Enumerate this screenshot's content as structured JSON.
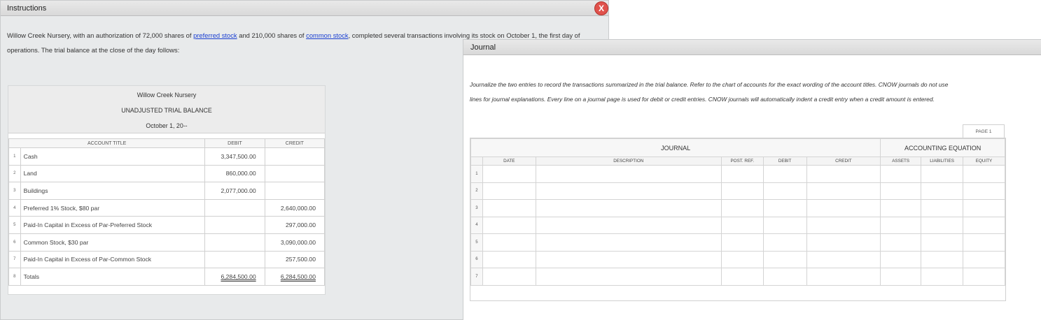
{
  "instructions_window": {
    "title": "Instructions",
    "close_label": "X",
    "intro_part1": "Willow Creek Nursery, with an authorization of 72,000 shares of ",
    "link_preferred": "preferred stock",
    "intro_part2": " and 210,000 shares of ",
    "link_common": "common stock",
    "intro_part3": ", completed several transactions involving its stock on October 1, the first day of operations. The trial balance at the close of the day follows:"
  },
  "trial_balance": {
    "company": "Willow Creek Nursery",
    "title": "UNADJUSTED TRIAL BALANCE",
    "date": "October 1, 20--",
    "columns": [
      "ACCOUNT TITLE",
      "DEBIT",
      "CREDIT"
    ],
    "rows": [
      {
        "num": "1",
        "account": "Cash",
        "debit": "3,347,500.00",
        "credit": ""
      },
      {
        "num": "2",
        "account": "Land",
        "debit": "860,000.00",
        "credit": ""
      },
      {
        "num": "3",
        "account": "Buildings",
        "debit": "2,077,000.00",
        "credit": ""
      },
      {
        "num": "4",
        "account": "Preferred 1% Stock, $80 par",
        "debit": "",
        "credit": "2,640,000.00"
      },
      {
        "num": "5",
        "account": "Paid-In Capital in Excess of Par-Preferred Stock",
        "debit": "",
        "credit": "297,000.00"
      },
      {
        "num": "6",
        "account": "Common Stock, $30 par",
        "debit": "",
        "credit": "3,090,000.00"
      },
      {
        "num": "7",
        "account": "Paid-In Capital in Excess of Par-Common Stock",
        "debit": "",
        "credit": "257,500.00"
      },
      {
        "num": "8",
        "account": "Totals",
        "debit": "6,284,500.00",
        "credit": "6,284,500.00"
      }
    ]
  },
  "journal_window": {
    "title": "Journal",
    "note_line1": "Journalize the two entries to record the transactions summarized in the trial balance. Refer to the chart of accounts for the exact wording of the account titles. CNOW journals do not use",
    "note_line2": "lines for journal explanations. Every line on a journal page is used for debit or credit entries. CNOW journals will automatically indent a credit entry when a credit amount is entered.",
    "page_label": "PAGE 1",
    "journal_header": "JOURNAL",
    "equation_header": "ACCOUNTING EQUATION",
    "columns": [
      "DATE",
      "DESCRIPTION",
      "POST. REF.",
      "DEBIT",
      "CREDIT",
      "ASSETS",
      "LIABILITIES",
      "EQUITY"
    ],
    "row_numbers": [
      "1",
      "2",
      "3",
      "4",
      "5",
      "6",
      "7"
    ]
  }
}
